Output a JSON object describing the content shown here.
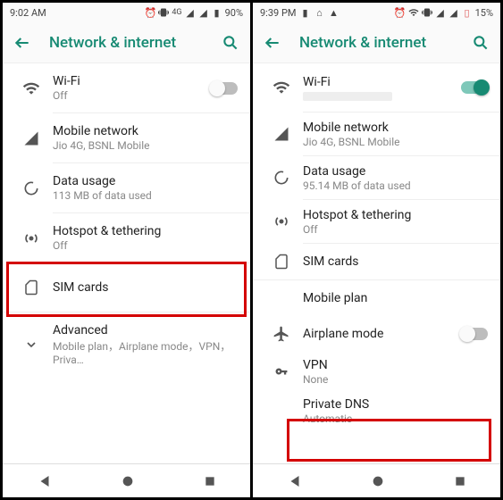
{
  "left": {
    "statusbar": {
      "time": "9:02 AM",
      "battery": "90%",
      "net": "4G"
    },
    "appbar": {
      "title": "Network & internet"
    },
    "rows": {
      "wifi": {
        "title": "Wi-Fi",
        "sub": "Off"
      },
      "mobile": {
        "title": "Mobile network",
        "sub": "Jio 4G, BSNL Mobile"
      },
      "data": {
        "title": "Data usage",
        "sub": "113 MB of data used"
      },
      "hotspot": {
        "title": "Hotspot & tethering",
        "sub": "Off"
      },
      "sim": {
        "title": "SIM cards"
      },
      "advanced": {
        "title": "Advanced",
        "sub": "Mobile plan，Airplane mode，VPN，Priva…"
      }
    }
  },
  "right": {
    "statusbar": {
      "time": "9:39 PM",
      "battery": "15%"
    },
    "appbar": {
      "title": "Network & internet"
    },
    "rows": {
      "wifi": {
        "title": "Wi-Fi"
      },
      "mobile": {
        "title": "Mobile network",
        "sub": "Jio 4G, BSNL Mobile"
      },
      "data": {
        "title": "Data usage",
        "sub": "95.14 MB of data used"
      },
      "hotspot": {
        "title": "Hotspot & tethering",
        "sub": "Off"
      },
      "sim": {
        "title": "SIM cards"
      },
      "plan": {
        "title": "Mobile plan"
      },
      "airplane": {
        "title": "Airplane mode"
      },
      "vpn": {
        "title": "VPN",
        "sub": "None"
      },
      "dns": {
        "title": "Private DNS",
        "sub": "Automatic"
      }
    }
  }
}
